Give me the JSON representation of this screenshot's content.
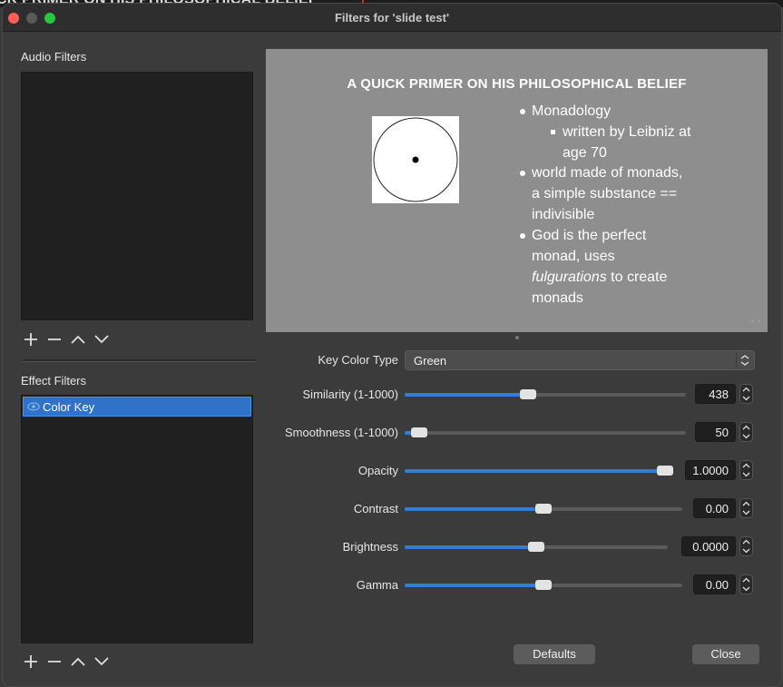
{
  "background": {
    "text": "CK PRIMER ON HIS PHILOSOPHICAL BELIEF"
  },
  "window": {
    "title": "Filters for 'slide test'"
  },
  "audio_filters": {
    "label": "Audio Filters",
    "items": []
  },
  "effect_filters": {
    "label": "Effect Filters",
    "items": [
      {
        "name": "Color Key",
        "selected": true,
        "visible": true
      }
    ]
  },
  "toolbar_icons": [
    "plus-icon",
    "minus-icon",
    "chevron-up-icon",
    "chevron-down-icon"
  ],
  "preview": {
    "title": "A QUICK PRIMER ON HIS PHILOSOPHICAL BELIEF",
    "bullets": {
      "b1": "Monadology",
      "b1_sub1": "written by Leibniz at",
      "b1_sub2": "age 70",
      "b2_l1": "world made of monads,",
      "b2_l2": "a simple substance ==",
      "b2_l3": "indivisible",
      "b3_l1": "God is the perfect",
      "b3_l2": "monad, uses",
      "b3_italic": "fulgurations",
      "b3_rest": " to create",
      "b3_l4": "monads"
    }
  },
  "properties": {
    "key_color_type": {
      "label": "Key Color Type",
      "value": "Green"
    },
    "similarity": {
      "label": "Similarity (1-1000)",
      "value": "438",
      "fraction": 0.438
    },
    "smoothness": {
      "label": "Smoothness (1-1000)",
      "value": "50",
      "fraction": 0.05
    },
    "opacity": {
      "label": "Opacity",
      "value": "1.0000",
      "fraction": 1.0
    },
    "contrast": {
      "label": "Contrast",
      "value": "0.00",
      "fraction": 0.5
    },
    "brightness": {
      "label": "Brightness",
      "value": "0.0000",
      "fraction": 0.5
    },
    "gamma": {
      "label": "Gamma",
      "value": "0.00",
      "fraction": 0.5
    }
  },
  "buttons": {
    "defaults": "Defaults",
    "close": "Close"
  },
  "colors": {
    "accent": "#2f7fd8",
    "selection": "#2f72c8",
    "window_bg": "#3b3b3b",
    "list_bg": "#202020",
    "preview_bg": "#8e8e8e"
  }
}
